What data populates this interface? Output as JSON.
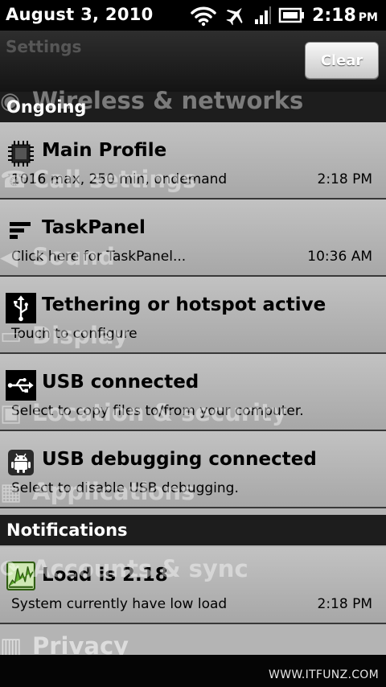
{
  "status_bar": {
    "date": "August 3, 2010",
    "time": "2:18",
    "ampm": "PM",
    "icons": [
      "wifi-icon",
      "airplane-mode-icon",
      "signal-icon",
      "battery-icon"
    ]
  },
  "background_settings": {
    "title": "Settings",
    "items": [
      "Wireless & networks",
      "Call settings",
      "Sound",
      "Display",
      "Location & security",
      "Applications",
      "Accounts & sync",
      "Privacy"
    ]
  },
  "header": {
    "clear_label": "Clear"
  },
  "sections": {
    "ongoing": "Ongoing",
    "notifications": "Notifications"
  },
  "notifications": [
    {
      "icon": "cpu-chip-icon",
      "title": "Main Profile",
      "subtitle": "1016 max, 250 min, ondemand",
      "time": "2:18 PM"
    },
    {
      "icon": "taskpanel-icon",
      "title": "TaskPanel",
      "subtitle": "Click here for TaskPanel...",
      "time": "10:36 AM"
    },
    {
      "icon": "usb-tether-icon",
      "title": "Tethering or hotspot active",
      "subtitle": "Touch to configure",
      "time": ""
    },
    {
      "icon": "usb-icon",
      "title": "USB connected",
      "subtitle": "Select to copy files to/from your computer.",
      "time": ""
    },
    {
      "icon": "android-debug-icon",
      "title": "USB debugging connected",
      "subtitle": "Select to disable USB debugging.",
      "time": ""
    },
    {
      "icon": "load-graph-icon",
      "title": "Load is 2.18",
      "subtitle": "System currently have low load",
      "time": "2:18 PM"
    }
  ],
  "watermark": "WWW.ITFUNZ.COM",
  "colors": {
    "shade": "#b4b4b4",
    "section_header": "#1d1d1d",
    "load_green": "#5fae2e"
  }
}
